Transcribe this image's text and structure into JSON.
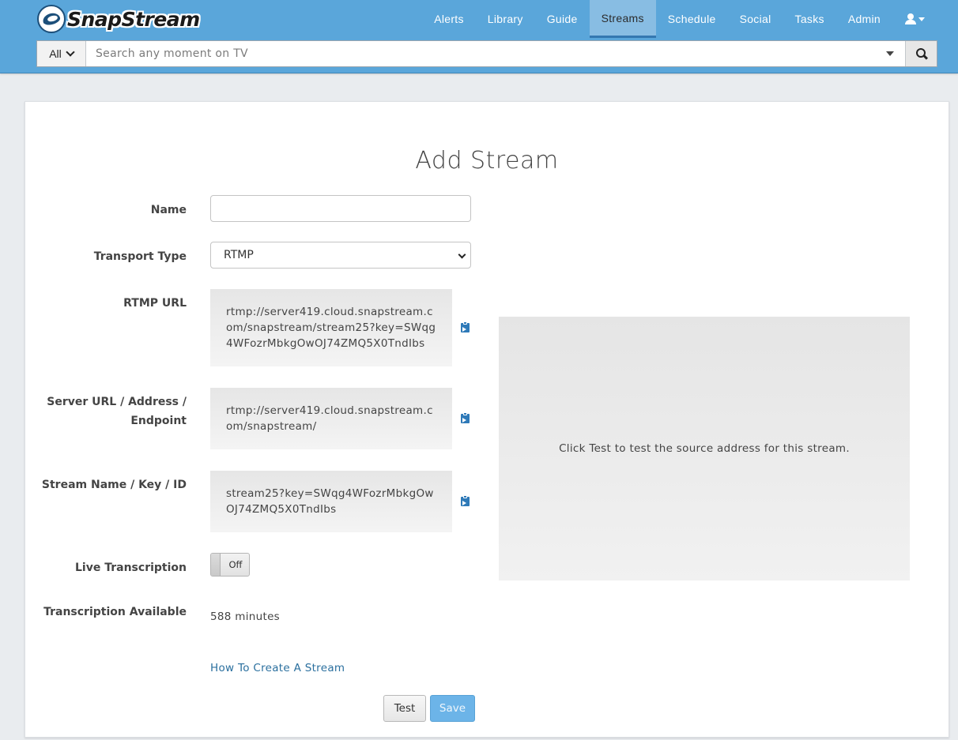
{
  "app": {
    "brand": "SnapStream"
  },
  "nav": {
    "items": [
      {
        "label": "Alerts"
      },
      {
        "label": "Library"
      },
      {
        "label": "Guide"
      },
      {
        "label": "Streams",
        "active": true
      },
      {
        "label": "Schedule"
      },
      {
        "label": "Social"
      },
      {
        "label": "Tasks"
      },
      {
        "label": "Admin"
      }
    ],
    "user_icon": "user-icon"
  },
  "search": {
    "scope": "All",
    "placeholder": "Search any moment on TV",
    "value": ""
  },
  "form": {
    "title": "Add Stream",
    "name_label": "Name",
    "name_value": "",
    "transport_label": "Transport Type",
    "transport_value": "RTMP",
    "rtmp_url_label": "RTMP URL",
    "rtmp_url_value": "rtmp://server419.cloud.snapstream.com/snapstream/stream25?key=SWqg4WFozrMbkgOwOJ74ZMQ5X0TndIbs",
    "server_url_label": "Server URL / Address / Endpoint",
    "server_url_value": "rtmp://server419.cloud.snapstream.com/snapstream/",
    "stream_key_label": "Stream Name / Key / ID",
    "stream_key_value": "stream25?key=SWqg4WFozrMbkgOwOJ74ZMQ5X0TndIbs",
    "live_transcription_label": "Live Transcription",
    "live_transcription_state": "Off",
    "transcription_available_label": "Transcription Available",
    "transcription_available_value": "588 minutes",
    "howto_link": "How To Create A Stream",
    "test_button": "Test",
    "save_button": "Save"
  },
  "preview": {
    "message": "Click Test to test the source address for this stream."
  },
  "colors": {
    "header_bg": "#5aa6da",
    "nav_active_bg": "#88bde3",
    "link": "#2a6f9e",
    "save_button": "#6cb4e8"
  }
}
